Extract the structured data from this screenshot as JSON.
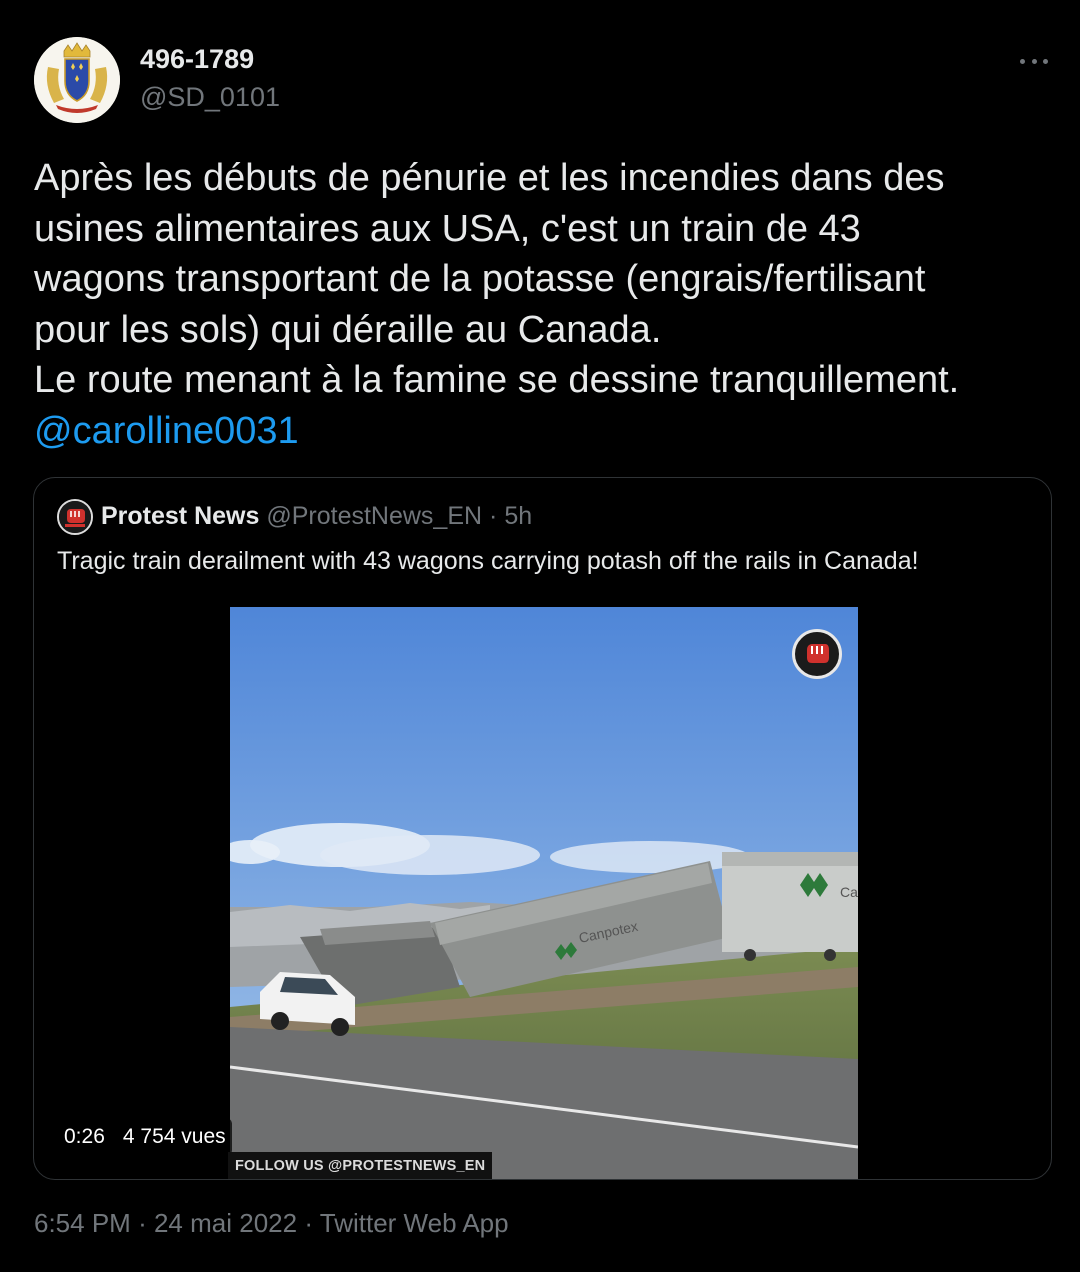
{
  "author": {
    "name": "496-1789",
    "handle": "@SD_0101"
  },
  "tweet": {
    "lines": [
      "Après les débuts de pénurie et les incendies dans des",
      "usines alimentaires aux USA, c'est un train de 43",
      "wagons transportant de la potasse (engrais/fertilisant",
      "pour les sols) qui déraille au Canada.",
      "Le route menant à la famine se dessine tranquillement."
    ],
    "mention": "@carolline0031"
  },
  "quote": {
    "name": "Protest News",
    "handle": "@ProtestNews_EN",
    "separator": "·",
    "time": "5h",
    "text": "Tragic train derailment with 43 wagons carrying potash off the rails in Canada!",
    "video": {
      "duration": "0:26",
      "views": "4 754 vues",
      "banner": "FOLLOW US @PROTESTNEWS_EN",
      "wagon_text": "Canpotex",
      "wagon_text_partial": "Ca"
    }
  },
  "meta": {
    "time": "6:54 PM",
    "sep1": "·",
    "date": "24 mai 2022",
    "sep2": "·",
    "source": "Twitter Web App"
  },
  "colors": {
    "background": "#000000",
    "text": "#e7e9ea",
    "muted": "#71767b",
    "link": "#1d9bf0",
    "border": "#2f3336"
  }
}
